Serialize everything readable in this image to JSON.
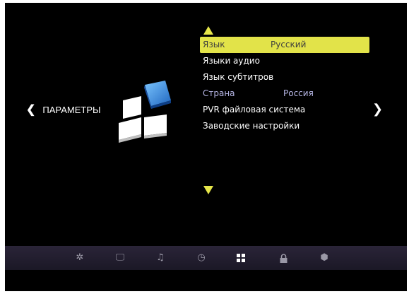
{
  "left_nav": {
    "label": "ПАРАМЕТРЫ",
    "left_chevron": "❮",
    "right_chevron": "❯"
  },
  "menu": {
    "items": [
      {
        "label": "Язык",
        "value": "Русский",
        "selected": true
      },
      {
        "label": "Языки аудио"
      },
      {
        "label": "Язык субтитров"
      },
      {
        "label": "Страна",
        "value": "Россия",
        "dim": true
      },
      {
        "label": "PVR файловая система"
      },
      {
        "label": "Заводские настройки"
      }
    ]
  },
  "bottom_bar": {
    "icons": [
      {
        "name": "settings-gear-icon",
        "glyph": "✲"
      },
      {
        "name": "monitor-icon",
        "glyph": "🖵"
      },
      {
        "name": "music-note-icon",
        "glyph": "♫"
      },
      {
        "name": "clock-icon",
        "glyph": "◷"
      },
      {
        "name": "grid-icon",
        "glyph": "■",
        "active": true
      },
      {
        "name": "lock-icon",
        "glyph": "🔒"
      },
      {
        "name": "box-icon",
        "glyph": "⬢"
      }
    ]
  },
  "colors": {
    "highlight": "#e2e349",
    "arrow": "#e6e64a",
    "cube_accent": "#2f8be0",
    "background": "#000000"
  }
}
